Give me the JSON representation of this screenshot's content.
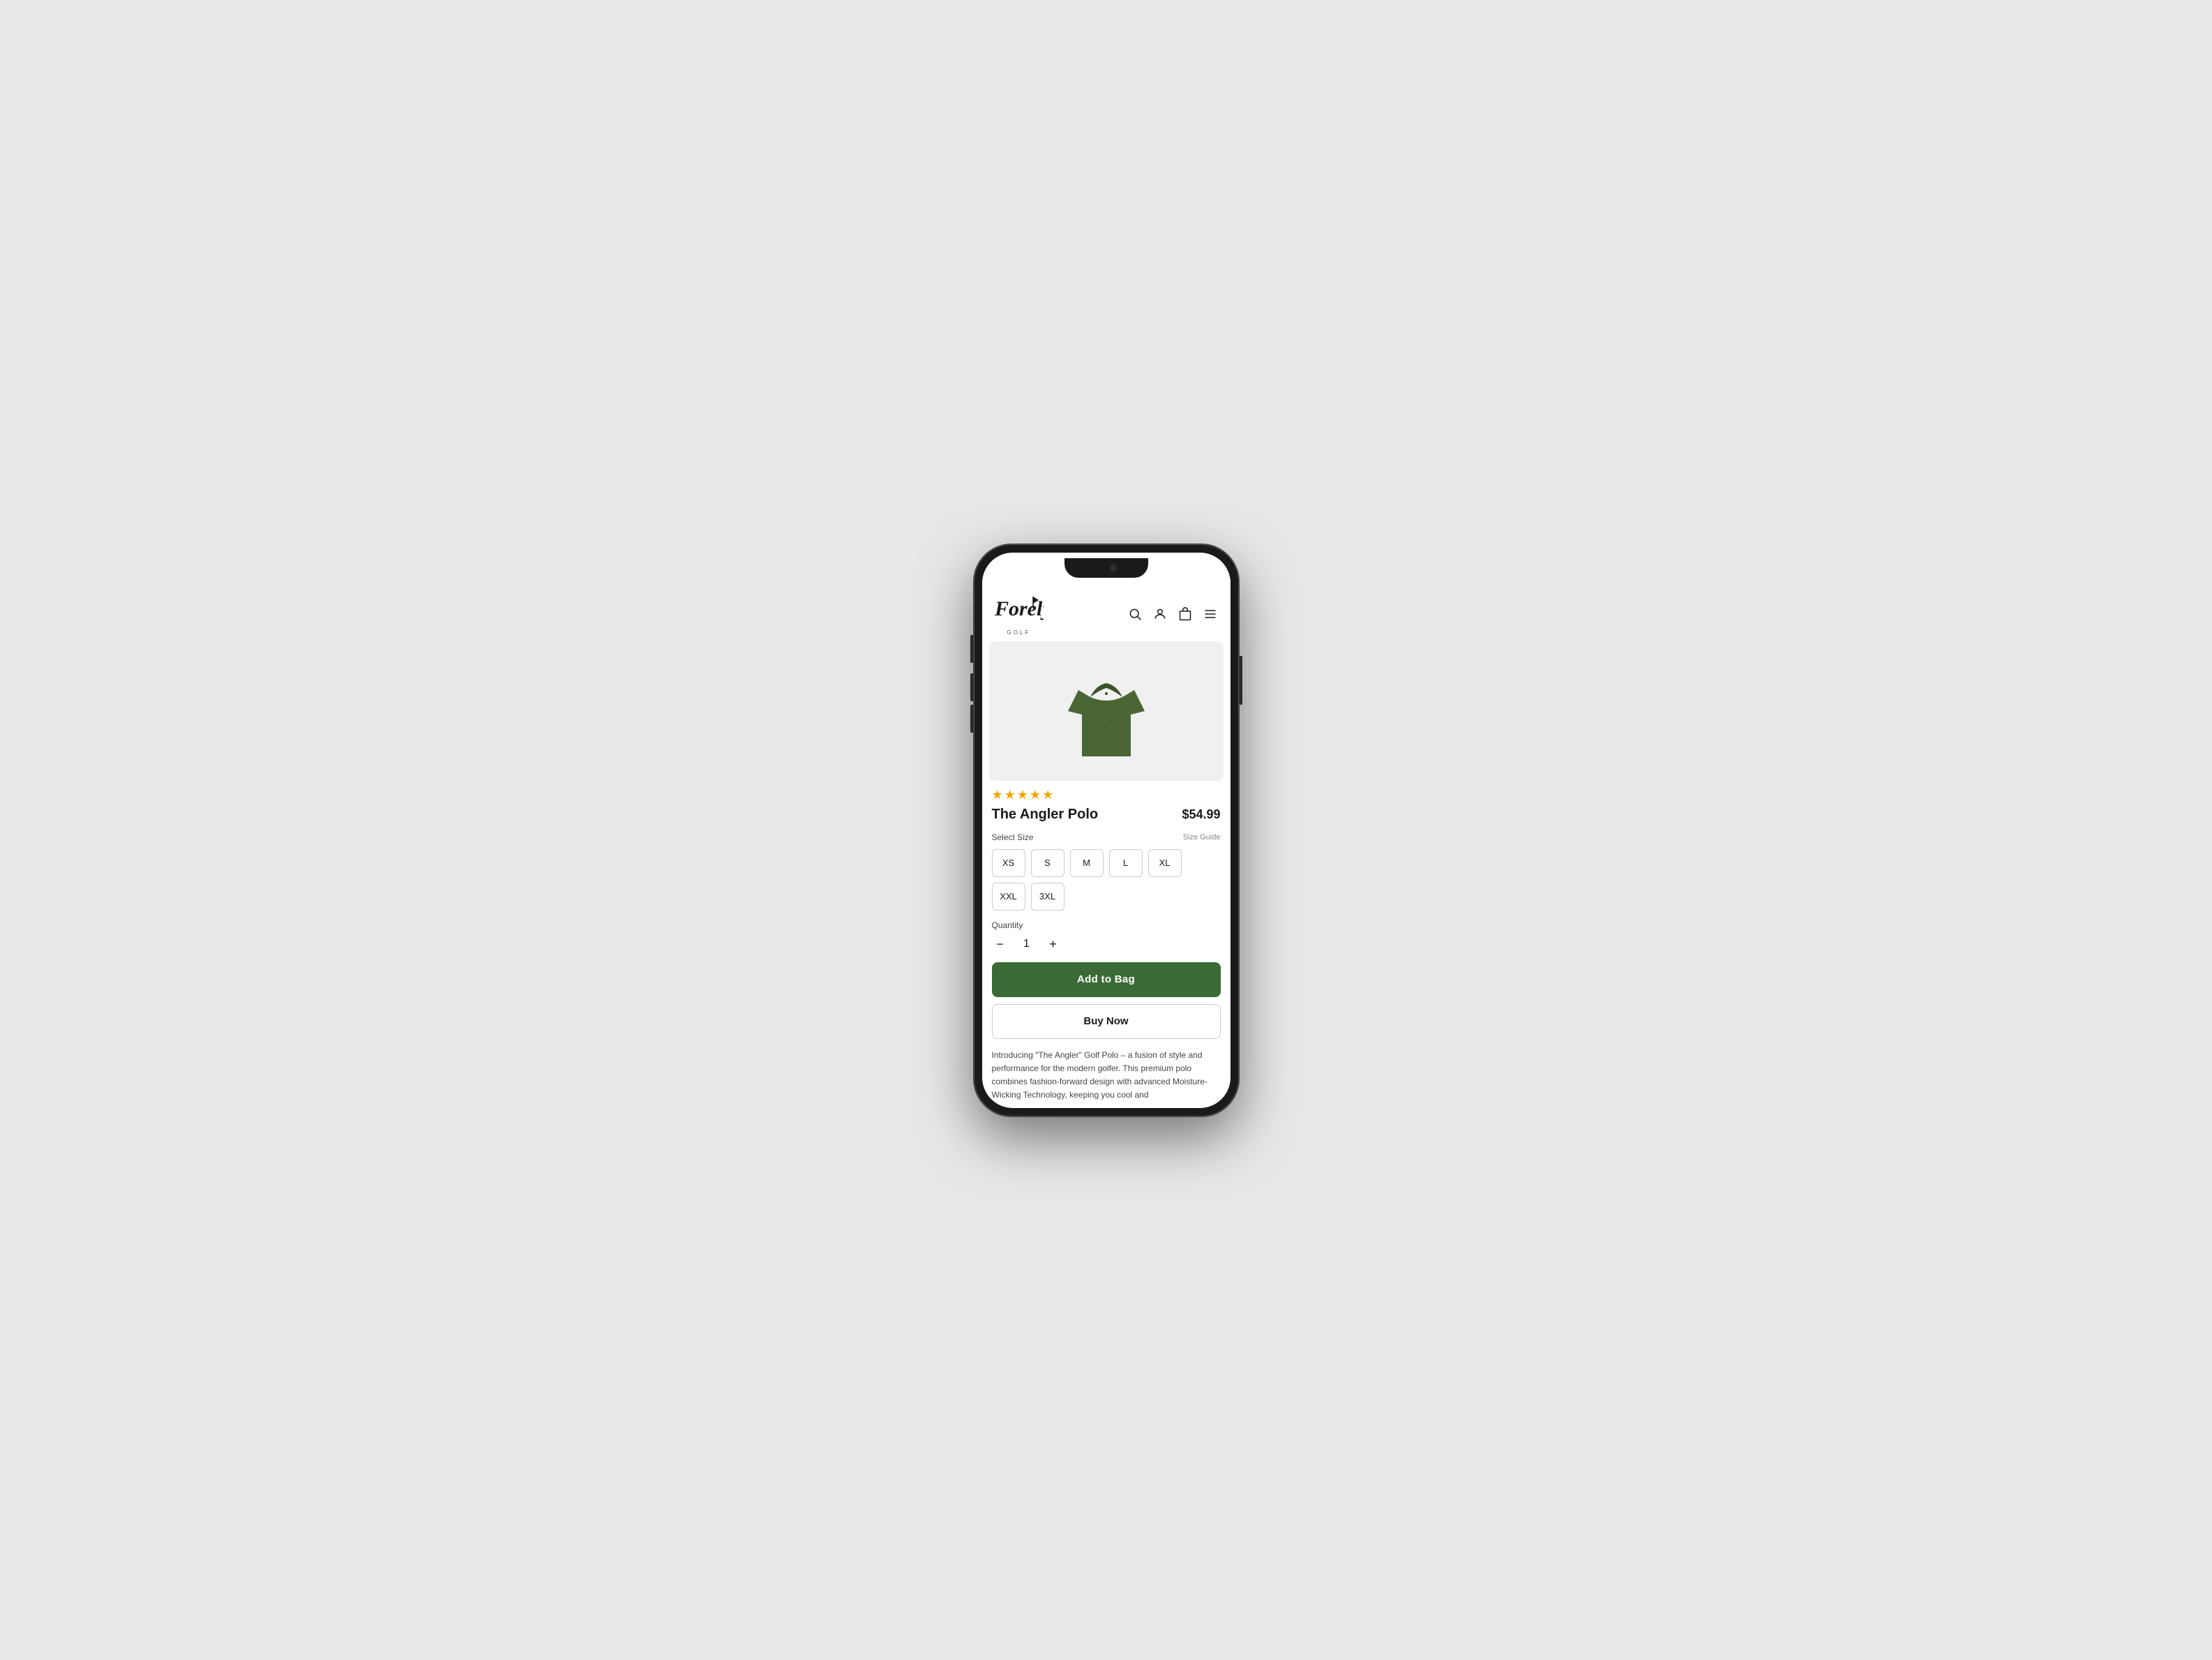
{
  "app": {
    "brand": "Forely",
    "brand_sub": "GOLF"
  },
  "header": {
    "search_label": "search",
    "account_label": "account",
    "bag_label": "bag",
    "menu_label": "menu"
  },
  "product": {
    "name": "The Angler Polo",
    "price": "$54.99",
    "rating": 4.5,
    "stars_count": 5,
    "rating_display": "★★★★★",
    "select_size_label": "Select Size",
    "size_guide_label": "Size Guide",
    "sizes": [
      "XS",
      "S",
      "M",
      "L",
      "XL",
      "XXL",
      "3XL"
    ],
    "quantity_label": "Quantity",
    "quantity_value": "1",
    "qty_minus": "−",
    "qty_plus": "+",
    "add_to_bag_label": "Add to Bag",
    "buy_now_label": "Buy Now",
    "description": "Introducing \"The Angler\" Golf Polo – a fusion of style and performance for the modern golfer. This premium polo combines fashion-forward design with advanced Moisture-Wicking Technology, keeping you cool and"
  },
  "colors": {
    "star_color": "#f0a500",
    "add_to_bag_bg": "#3a6b35",
    "shirt_color": "#4a6635"
  }
}
